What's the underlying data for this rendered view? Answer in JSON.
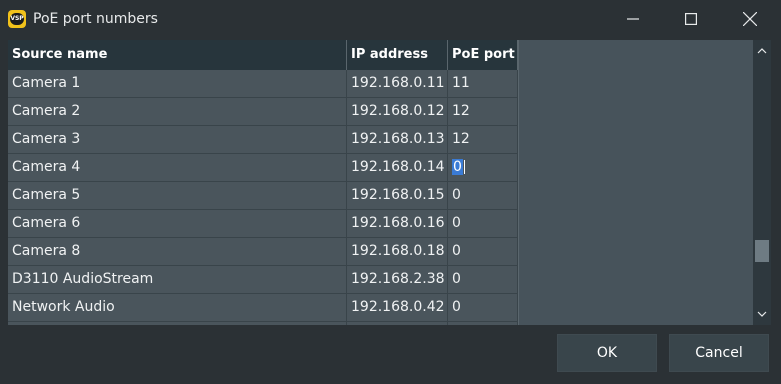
{
  "window": {
    "title": "PoE port numbers",
    "app_icon_text": "VSP"
  },
  "table": {
    "columns": [
      "Source name",
      "IP address",
      "PoE port"
    ],
    "rows": [
      {
        "name": "Camera 1",
        "ip": "192.168.0.11",
        "port": "11"
      },
      {
        "name": "Camera 2",
        "ip": "192.168.0.12",
        "port": "12"
      },
      {
        "name": "Camera 3",
        "ip": "192.168.0.13",
        "port": "12"
      },
      {
        "name": "Camera 4",
        "ip": "192.168.0.14",
        "port": "0"
      },
      {
        "name": "Camera 5",
        "ip": "192.168.0.15",
        "port": "0"
      },
      {
        "name": "Camera 6",
        "ip": "192.168.0.16",
        "port": "0"
      },
      {
        "name": "Camera 8",
        "ip": "192.168.0.18",
        "port": "0"
      },
      {
        "name": "D3110 AudioStream",
        "ip": "192.168.2.38",
        "port": "0"
      },
      {
        "name": "Network Audio",
        "ip": "192.168.0.42",
        "port": "0"
      },
      {
        "name": "",
        "ip": "",
        "port": ""
      }
    ],
    "editing_row": 3
  },
  "buttons": {
    "ok": "OK",
    "cancel": "Cancel"
  },
  "colors": {
    "background": "#2b3135",
    "header_bg": "#27353c",
    "row_bg": "#4a555c",
    "selection": "#3a7bd5",
    "button_bg": "#39454b"
  },
  "icons": {
    "minimize": "minimize-icon",
    "maximize": "maximize-icon",
    "close": "close-icon",
    "scroll_up": "chevron-up-icon",
    "scroll_down": "chevron-down-icon"
  }
}
